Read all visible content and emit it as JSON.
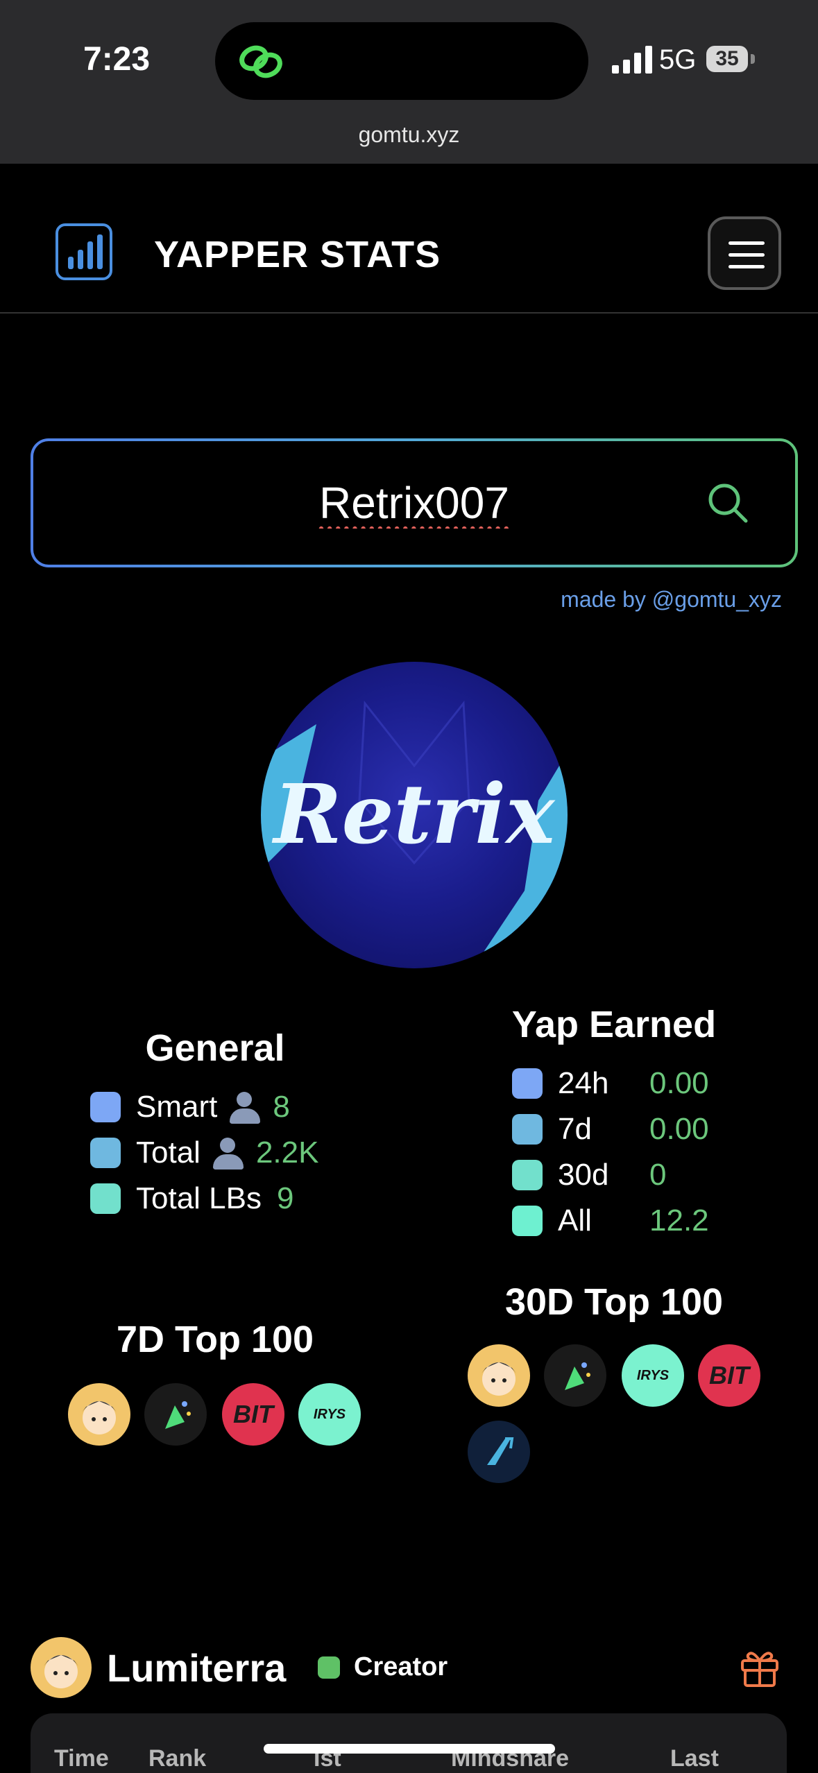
{
  "status_bar": {
    "time": "7:23",
    "network": "5G",
    "battery": "35",
    "url": "gomtu.xyz"
  },
  "header": {
    "title": "YAPPER STATS",
    "logo_icon": "bar-chart-icon",
    "menu_icon": "hamburger-menu-icon"
  },
  "search": {
    "value": "Retrix007",
    "placeholder": "",
    "icon": "search-icon"
  },
  "credit": "made by @gomtu_xyz",
  "profile": {
    "avatar_text": "Retrix"
  },
  "general": {
    "title": "General",
    "items": [
      {
        "label": "Smart",
        "value": "8",
        "color": "#7da7f5"
      },
      {
        "label": "Total",
        "value": "2.2K",
        "color": "#6fb8e0"
      },
      {
        "label": "Total LBs",
        "value": "9",
        "color": "#72e0cc"
      }
    ]
  },
  "yap_earned": {
    "title": "Yap Earned",
    "items": [
      {
        "label": "24h",
        "value": "0.00",
        "color": "#7da7f5"
      },
      {
        "label": "7d",
        "value": "0.00",
        "color": "#6fb8e0"
      },
      {
        "label": "30d",
        "value": "0",
        "color": "#72e0cc"
      },
      {
        "label": "All",
        "value": "12.2",
        "color": "#6ef0d0"
      }
    ]
  },
  "top7": {
    "title": "7D Top 100",
    "tiles": [
      "BIT",
      "IRYS"
    ]
  },
  "top30": {
    "title": "30D Top 100",
    "tiles": [
      "IRYS",
      "BIT"
    ]
  },
  "project": {
    "name": "Lumiterra",
    "role": "Creator",
    "role_color": "#5fc166"
  },
  "table": {
    "headers": [
      "Time",
      "Rank",
      "Ist",
      "Mindshare",
      "Last"
    ]
  },
  "colors": {
    "accent_blue": "#4f7fe6",
    "accent_green": "#5ec37a",
    "value_green": "#6cc77c"
  }
}
